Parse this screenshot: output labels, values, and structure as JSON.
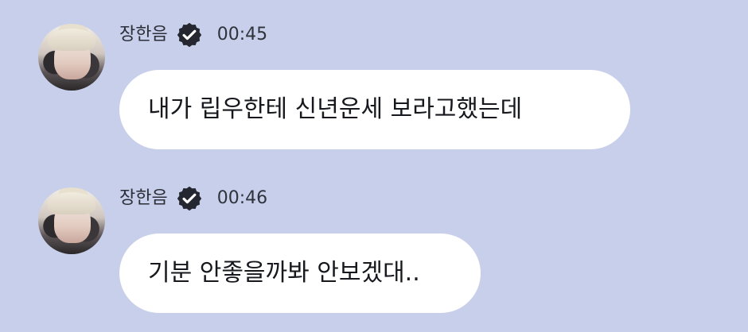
{
  "chat": {
    "messages": [
      {
        "sender": "장한음",
        "time": "00:45",
        "text": "내가 립우한테 신년운세 보라고했는데",
        "verified_icon": "verified-badge-icon"
      },
      {
        "sender": "장한음",
        "time": "00:46",
        "text": "기분 안좋을까봐 안보겠대..",
        "verified_icon": "verified-badge-icon"
      }
    ]
  },
  "colors": {
    "background": "#c8cfea",
    "bubble": "#ffffff",
    "text": "#16181d",
    "verified_badge": "#24272f"
  }
}
